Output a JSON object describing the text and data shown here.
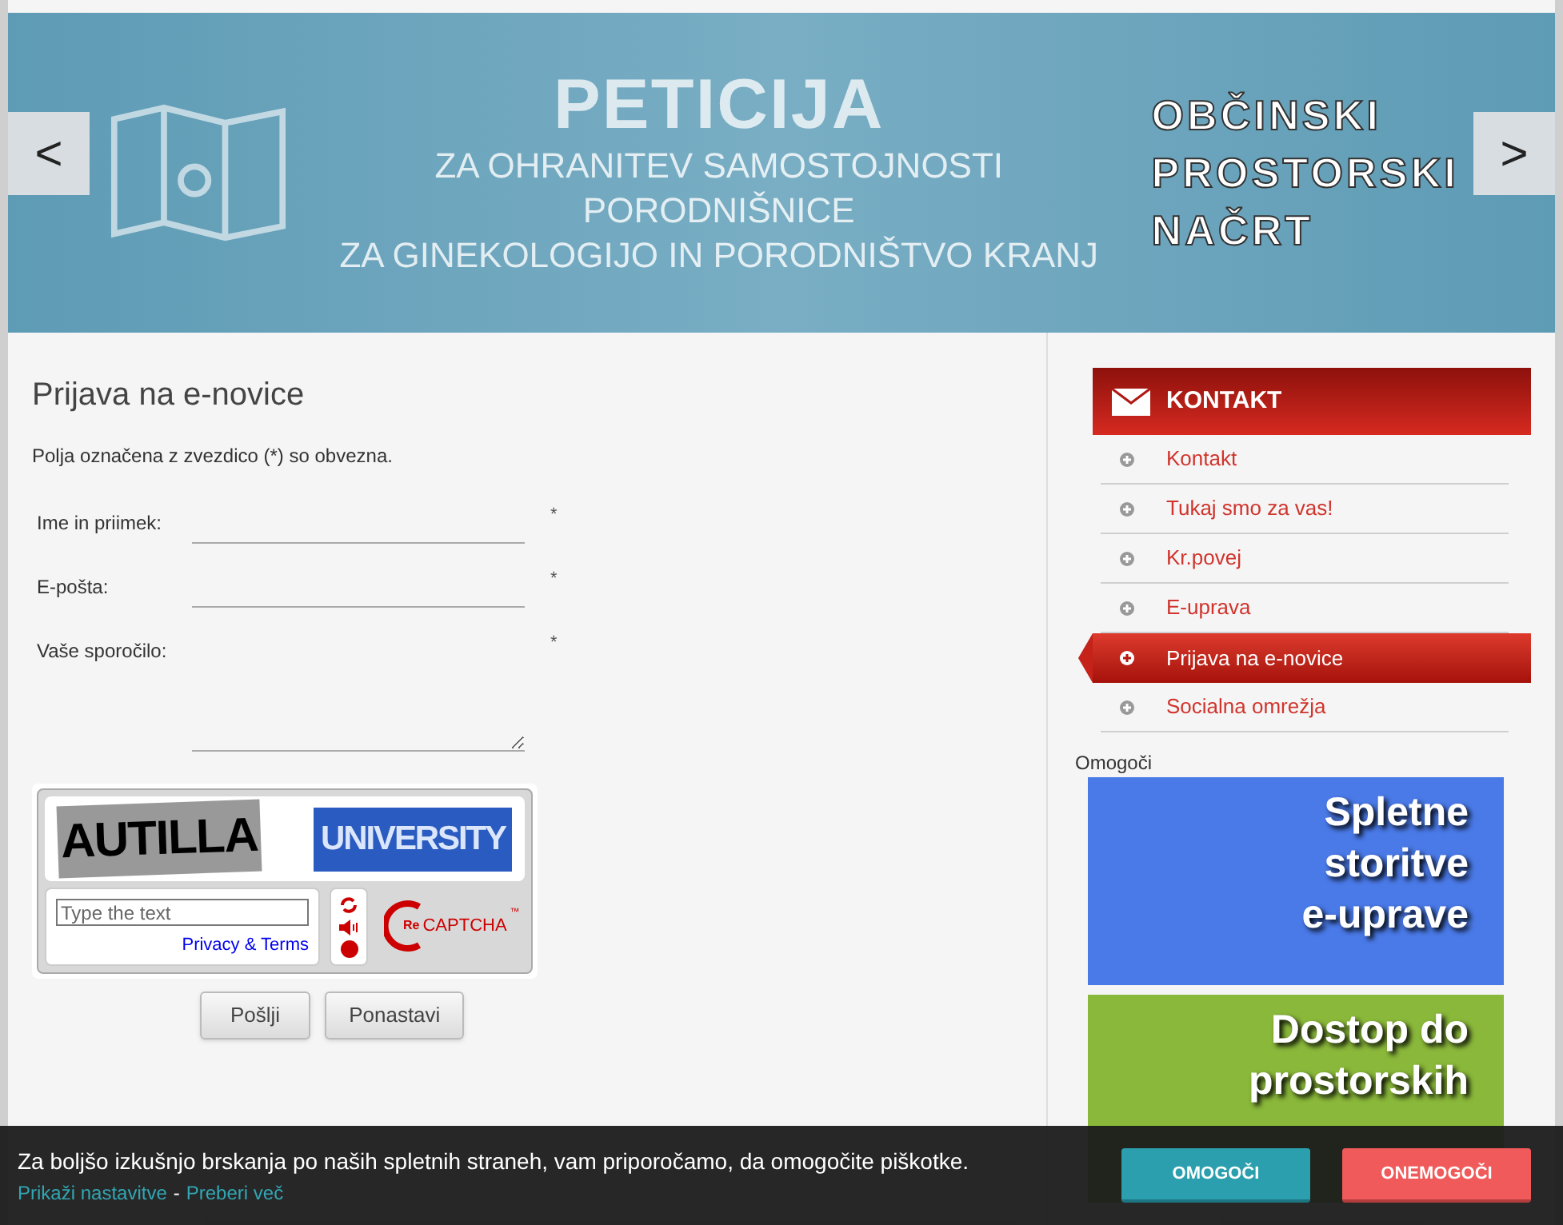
{
  "banner": {
    "prev": "<",
    "next": ">",
    "slides": [
      {
        "kind": "big",
        "text": "PETICIJA"
      },
      {
        "kind": "outline",
        "text": "OBČINSKI"
      },
      {
        "kind": "line",
        "text": "ZA OHRANITEV SAMOSTOJNOSTI"
      },
      {
        "kind": "outline",
        "text": "PROSTORSKI"
      },
      {
        "kind": "line",
        "text": "PORODNIŠNICE"
      },
      {
        "kind": "outline",
        "text": "NAČRT"
      },
      {
        "kind": "line",
        "text": "ZA GINEKOLOGIJO IN PORODNIŠTVO KRANJ"
      }
    ]
  },
  "form": {
    "title": "Prijava na e-novice",
    "note": "Polja označena z zvezdico (*) so obvezna.",
    "fields": [
      {
        "kind": "input",
        "label": "Ime in priimek:",
        "required": "*"
      },
      {
        "kind": "input",
        "label": "E-pošta:",
        "required": "*"
      },
      {
        "kind": "textarea",
        "label": "Vaše sporočilo:",
        "required": "*"
      }
    ],
    "captcha": {
      "words": [
        "AUTILLA",
        "UNIVERSITY"
      ],
      "placeholder": "Type the text",
      "link": "Privacy & Terms",
      "logo_re": "Re",
      "logo": "CAPTCHA",
      "tm": "™"
    },
    "buttons": [
      "Pošlji",
      "Ponastavi"
    ]
  },
  "sidebar": {
    "title": "KONTAKT",
    "items": [
      {
        "label": "Kontakt",
        "selected": false
      },
      {
        "label": "Tukaj smo za vas!",
        "selected": false
      },
      {
        "label": "Kr.povej",
        "selected": false
      },
      {
        "label": "E-uprava",
        "selected": false
      },
      {
        "label": "Prijava na e-novice",
        "selected": true
      },
      {
        "label": "Socialna omrežja",
        "selected": false
      }
    ],
    "caption": "Omogoči",
    "promos": [
      {
        "lines": [
          "Spletne",
          "storitve",
          "e-uprave"
        ],
        "color": "#4a7ae8"
      },
      {
        "lines": [
          "Dostop do",
          "prostorskih"
        ],
        "color": "#8ab83a"
      }
    ]
  },
  "cookie_bar": {
    "message": "Za boljšo izkušnjo brskanja po naših spletnih straneh, vam priporočamo, da omogočite piškotke.",
    "settings_link": "Prikaži nastavitve",
    "separator": "-",
    "more_link": "Preberi več",
    "accept": "OMOGOČI",
    "reject": "ONEMOGOČI"
  }
}
